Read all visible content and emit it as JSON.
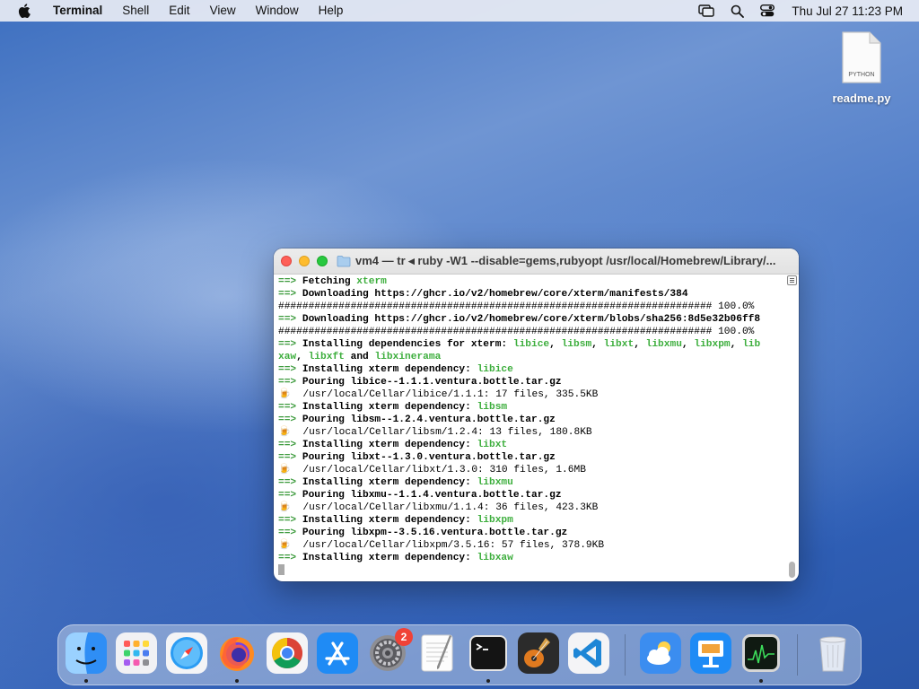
{
  "menubar": {
    "app_name": "Terminal",
    "items": [
      "Shell",
      "Edit",
      "View",
      "Window",
      "Help"
    ],
    "status_icons": [
      "screen-mirroring-icon",
      "search-icon",
      "control-center-icon"
    ],
    "clock": "Thu Jul 27  11:23 PM"
  },
  "desktop": {
    "file": {
      "badge": "PYTHON",
      "name": "readme.py"
    }
  },
  "window": {
    "title": "vm4 — tr ◂ ruby -W1 --disable=gems,rubyopt /usr/local/Homebrew/Library/...",
    "lines": [
      [
        [
          "a",
          "==>"
        ],
        [
          "b",
          " Fetching "
        ],
        [
          "g",
          "xterm"
        ]
      ],
      [
        [
          "a",
          "==>"
        ],
        [
          "b",
          " Downloading https://ghcr.io/v2/homebrew/core/xterm/manifests/384"
        ]
      ],
      [
        [
          "t",
          "######################################################################## 100.0%"
        ]
      ],
      [
        [
          "a",
          "==>"
        ],
        [
          "b",
          " Downloading https://ghcr.io/v2/homebrew/core/xterm/blobs/sha256:8d5e32b06ff8"
        ]
      ],
      [
        [
          "t",
          "######################################################################## 100.0%"
        ]
      ],
      [
        [
          "a",
          "==>"
        ],
        [
          "b",
          " Installing dependencies for xterm: "
        ],
        [
          "g",
          "libice"
        ],
        [
          "b",
          ", "
        ],
        [
          "g",
          "libsm"
        ],
        [
          "b",
          ", "
        ],
        [
          "g",
          "libxt"
        ],
        [
          "b",
          ", "
        ],
        [
          "g",
          "libxmu"
        ],
        [
          "b",
          ", "
        ],
        [
          "g",
          "libxpm"
        ],
        [
          "b",
          ", "
        ],
        [
          "g",
          "lib"
        ]
      ],
      [
        [
          "g",
          "xaw"
        ],
        [
          "b",
          ", "
        ],
        [
          "g",
          "libxft"
        ],
        [
          "b",
          " and "
        ],
        [
          "g",
          "libxinerama"
        ]
      ],
      [
        [
          "a",
          "==>"
        ],
        [
          "b",
          " Installing xterm dependency: "
        ],
        [
          "g",
          "libice"
        ]
      ],
      [
        [
          "a",
          "==>"
        ],
        [
          "b",
          " Pouring libice--1.1.1.ventura.bottle.tar.gz"
        ]
      ],
      [
        [
          "e",
          "🍺"
        ],
        [
          "t",
          "  /usr/local/Cellar/libice/1.1.1: 17 files, 335.5KB"
        ]
      ],
      [
        [
          "a",
          "==>"
        ],
        [
          "b",
          " Installing xterm dependency: "
        ],
        [
          "g",
          "libsm"
        ]
      ],
      [
        [
          "a",
          "==>"
        ],
        [
          "b",
          " Pouring libsm--1.2.4.ventura.bottle.tar.gz"
        ]
      ],
      [
        [
          "e",
          "🍺"
        ],
        [
          "t",
          "  /usr/local/Cellar/libsm/1.2.4: 13 files, 180.8KB"
        ]
      ],
      [
        [
          "a",
          "==>"
        ],
        [
          "b",
          " Installing xterm dependency: "
        ],
        [
          "g",
          "libxt"
        ]
      ],
      [
        [
          "a",
          "==>"
        ],
        [
          "b",
          " Pouring libxt--1.3.0.ventura.bottle.tar.gz"
        ]
      ],
      [
        [
          "e",
          "🍺"
        ],
        [
          "t",
          "  /usr/local/Cellar/libxt/1.3.0: 310 files, 1.6MB"
        ]
      ],
      [
        [
          "a",
          "==>"
        ],
        [
          "b",
          " Installing xterm dependency: "
        ],
        [
          "g",
          "libxmu"
        ]
      ],
      [
        [
          "a",
          "==>"
        ],
        [
          "b",
          " Pouring libxmu--1.1.4.ventura.bottle.tar.gz"
        ]
      ],
      [
        [
          "e",
          "🍺"
        ],
        [
          "t",
          "  /usr/local/Cellar/libxmu/1.1.4: 36 files, 423.3KB"
        ]
      ],
      [
        [
          "a",
          "==>"
        ],
        [
          "b",
          " Installing xterm dependency: "
        ],
        [
          "g",
          "libxpm"
        ]
      ],
      [
        [
          "a",
          "==>"
        ],
        [
          "b",
          " Pouring libxpm--3.5.16.ventura.bottle.tar.gz"
        ]
      ],
      [
        [
          "e",
          "🍺"
        ],
        [
          "t",
          "  /usr/local/Cellar/libxpm/3.5.16: 57 files, 378.9KB"
        ]
      ],
      [
        [
          "a",
          "==>"
        ],
        [
          "b",
          " Installing xterm dependency: "
        ],
        [
          "g",
          "libxaw"
        ]
      ]
    ]
  },
  "dock": {
    "apps": [
      {
        "name": "finder",
        "running": true
      },
      {
        "name": "launchpad",
        "running": false
      },
      {
        "name": "safari",
        "running": false
      },
      {
        "name": "firefox",
        "running": true
      },
      {
        "name": "chrome",
        "running": false
      },
      {
        "name": "app-store",
        "running": false
      },
      {
        "name": "system-settings",
        "running": false,
        "badge": "2"
      },
      {
        "name": "textedit",
        "running": false
      },
      {
        "name": "terminal",
        "running": true
      },
      {
        "name": "garageband",
        "running": false
      },
      {
        "name": "vscode",
        "running": false
      },
      {
        "name": "weather",
        "running": false
      },
      {
        "name": "keynote",
        "running": false
      },
      {
        "name": "activity-monitor",
        "running": true
      },
      {
        "name": "trash",
        "running": false
      }
    ]
  }
}
